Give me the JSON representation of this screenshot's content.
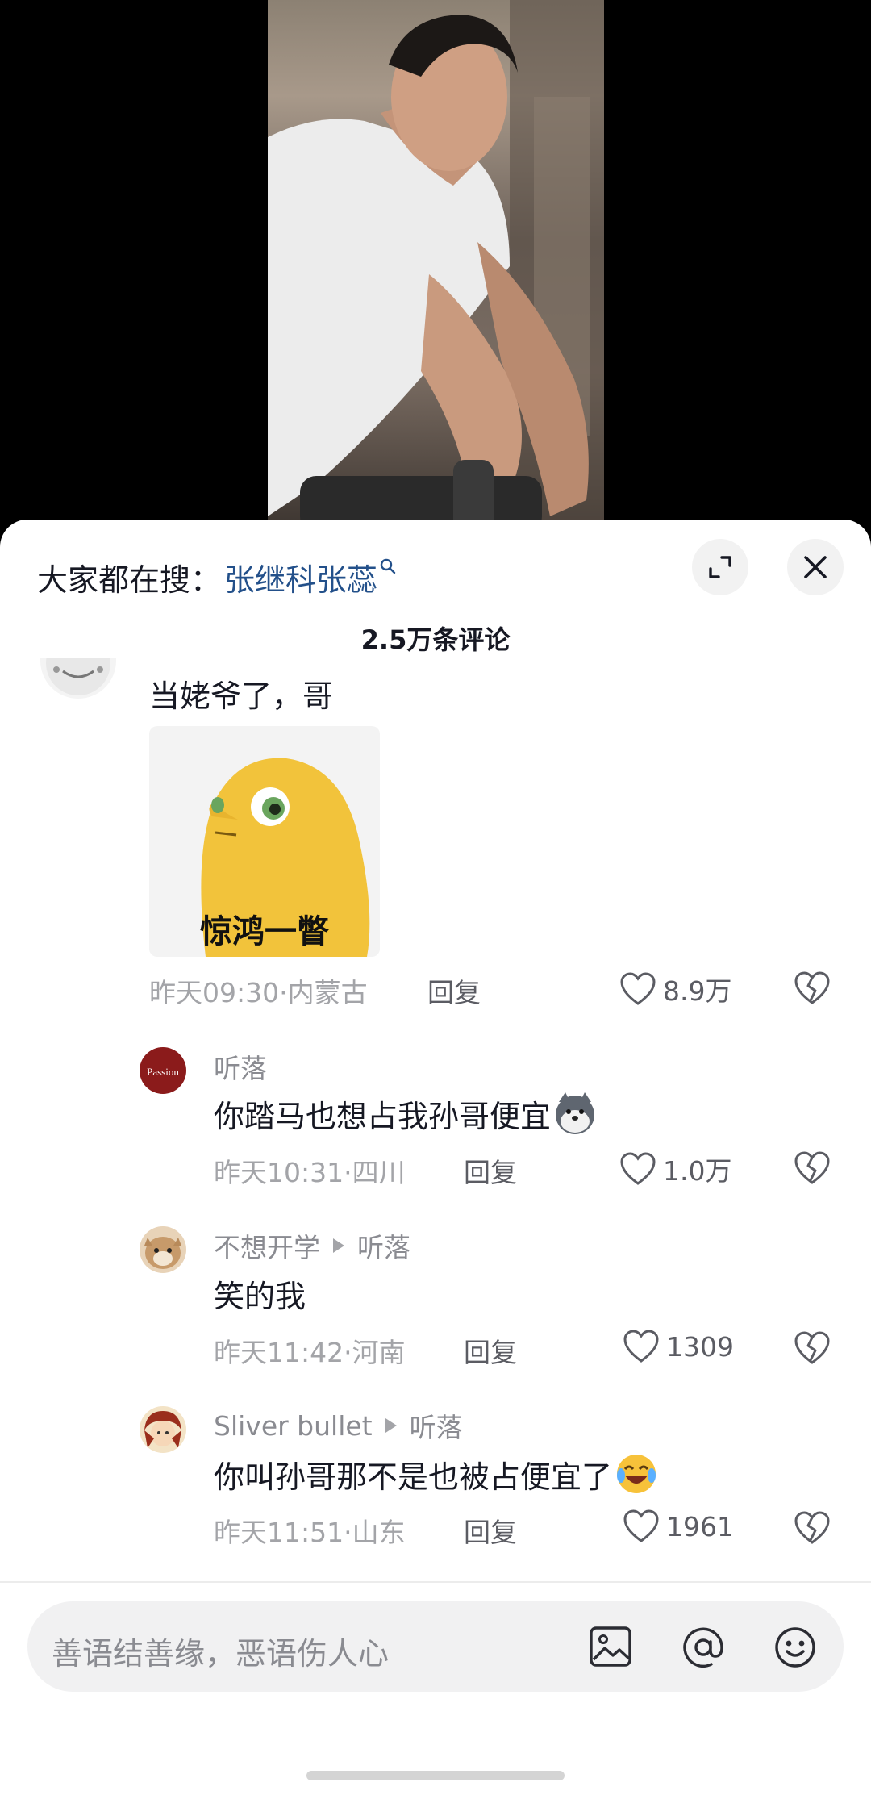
{
  "search": {
    "prefix": "大家都在搜：",
    "term": "张继科张蕊"
  },
  "comments_count": "2.5万条评论",
  "comments": [
    {
      "author": "",
      "text": "当姥爷了，哥",
      "sticker_caption": "惊鸿一瞥",
      "meta": "昨天09:30·内蒙古",
      "reply": "回复",
      "likes": "8.9万"
    },
    {
      "author": "听落",
      "avatar_label": "Passion",
      "text": "你踏马也想占我孙哥便宜",
      "meta": "昨天10:31·四川",
      "reply": "回复",
      "likes": "1.0万"
    },
    {
      "author": "不想开学",
      "reply_to": "听落",
      "text": "笑的我",
      "meta": "昨天11:42·河南",
      "reply": "回复",
      "likes": "1309"
    },
    {
      "author": "Sliver  bullet",
      "reply_to": "听落",
      "text": "你叫孙哥那不是也被占便宜了",
      "meta": "昨天11:51·山东",
      "reply": "回复",
      "likes": "1961"
    }
  ],
  "input": {
    "placeholder": "善语结善缘，恶语伤人心"
  },
  "icons": [
    "search-icon",
    "expand-icon",
    "close-icon",
    "heart-icon",
    "broken-heart-icon",
    "image-icon",
    "at-icon",
    "emoji-icon"
  ]
}
